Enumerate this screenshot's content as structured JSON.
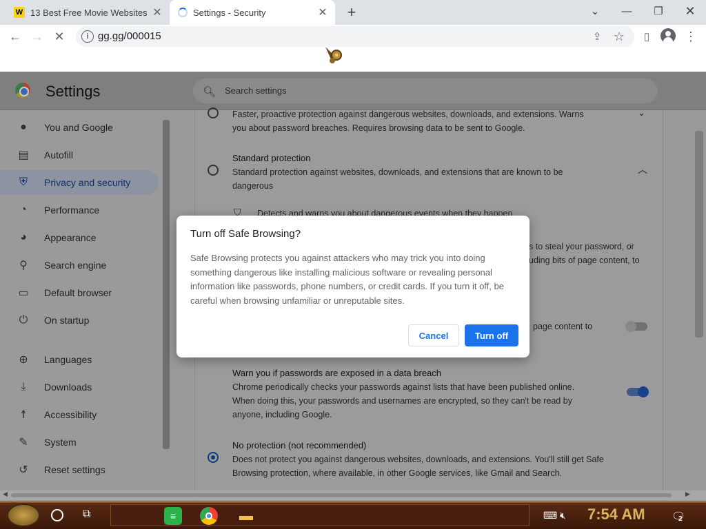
{
  "tabs": [
    {
      "title": "13 Best Free Movie Websites O",
      "favicon": "W"
    },
    {
      "title": "Settings - Security"
    }
  ],
  "address": {
    "url": "gg.gg/000015"
  },
  "settings": {
    "title": "Settings",
    "search_placeholder": "Search settings",
    "nav": [
      {
        "label": "You and Google",
        "icon": "person-icon"
      },
      {
        "label": "Autofill",
        "icon": "clipboard-icon"
      },
      {
        "label": "Privacy and security",
        "icon": "shield-icon",
        "selected": true
      },
      {
        "label": "Performance",
        "icon": "gauge-icon"
      },
      {
        "label": "Appearance",
        "icon": "palette-icon"
      },
      {
        "label": "Search engine",
        "icon": "search-icon"
      },
      {
        "label": "Default browser",
        "icon": "browser-icon"
      },
      {
        "label": "On startup",
        "icon": "power-icon"
      },
      {
        "label": "Languages",
        "icon": "globe-icon"
      },
      {
        "label": "Downloads",
        "icon": "download-icon"
      },
      {
        "label": "Accessibility",
        "icon": "accessibility-icon"
      },
      {
        "label": "System",
        "icon": "wrench-icon"
      },
      {
        "label": "Reset settings",
        "icon": "reset-icon"
      }
    ],
    "content": {
      "enhanced_desc_1": "Faster, proactive protection against dangerous websites, downloads, and extensions. Warns",
      "enhanced_desc_2": "you about password breaches. Requires browsing data to be sent to Google.",
      "standard_title": "Standard protection",
      "standard_desc_1": "Standard protection against websites, downloads, and extensions that are known to be",
      "standard_desc_2": "dangerous",
      "detects_partial": "Detects and warns you about dangerous events when they happen",
      "steal_partial": "s to steal your password, or",
      "bits_partial": "uding bits of page content, to",
      "page_content_partial": "page content to",
      "warn_title": "Warn you if passwords are exposed in a data breach",
      "warn_desc_1": "Chrome periodically checks your passwords against lists that have been published online.",
      "warn_desc_2": "When doing this, your passwords and usernames are encrypted, so they can't be read by",
      "warn_desc_3": "anyone, including Google.",
      "noprot_title": "No protection (not recommended)",
      "noprot_desc_1": "Does not protect you against dangerous websites, downloads, and extensions. You'll still get Safe",
      "noprot_desc_2": "Browsing protection, where available, in other Google services, like Gmail and Search."
    }
  },
  "dialog": {
    "title": "Turn off Safe Browsing?",
    "body": "Safe Browsing protects you against attackers who may trick you into doing something dangerous like installing malicious software or revealing personal information like passwords, phone numbers, or credit cards. If you turn it off, be careful when browsing unfamiliar or unreputable sites.",
    "cancel": "Cancel",
    "confirm": "Turn off"
  },
  "taskbar": {
    "time": "7:54 AM",
    "notification_count": "2"
  },
  "colors": {
    "accent": "#1a73e8",
    "taskbar": "#4a1e0e",
    "clock": "#d8b45a"
  }
}
